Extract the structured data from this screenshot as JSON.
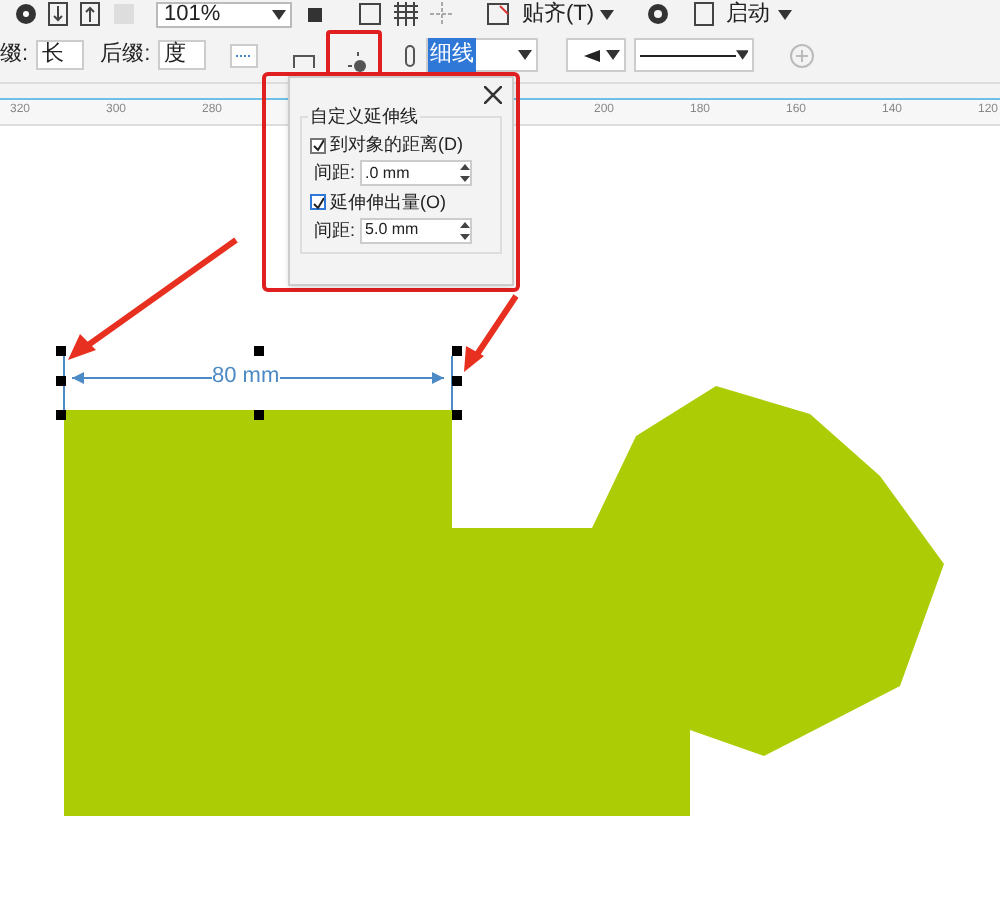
{
  "toolbar_top": {
    "zoom": "101%",
    "snap": "贴齐(T)",
    "launch": "启动"
  },
  "property_bar": {
    "prefix_label": "缀:",
    "prefix": "长",
    "suffix_label": "后缀:",
    "suffix": "度",
    "line_style": "细线"
  },
  "ruler": {
    "ticks": [
      "320",
      "300",
      "280",
      "200",
      "180",
      "160",
      "140",
      "120"
    ]
  },
  "popup": {
    "group_title": "自定义延伸线",
    "options": [
      {
        "label": "到对象的距离(D)",
        "checked": true,
        "spacing_label": "间距:",
        "spacing": ".0 mm"
      },
      {
        "label": "延伸伸出量(O)",
        "checked": true,
        "spacing_label": "间距:",
        "spacing": "5.0 mm"
      }
    ]
  },
  "dimension": {
    "text": "80 mm"
  }
}
